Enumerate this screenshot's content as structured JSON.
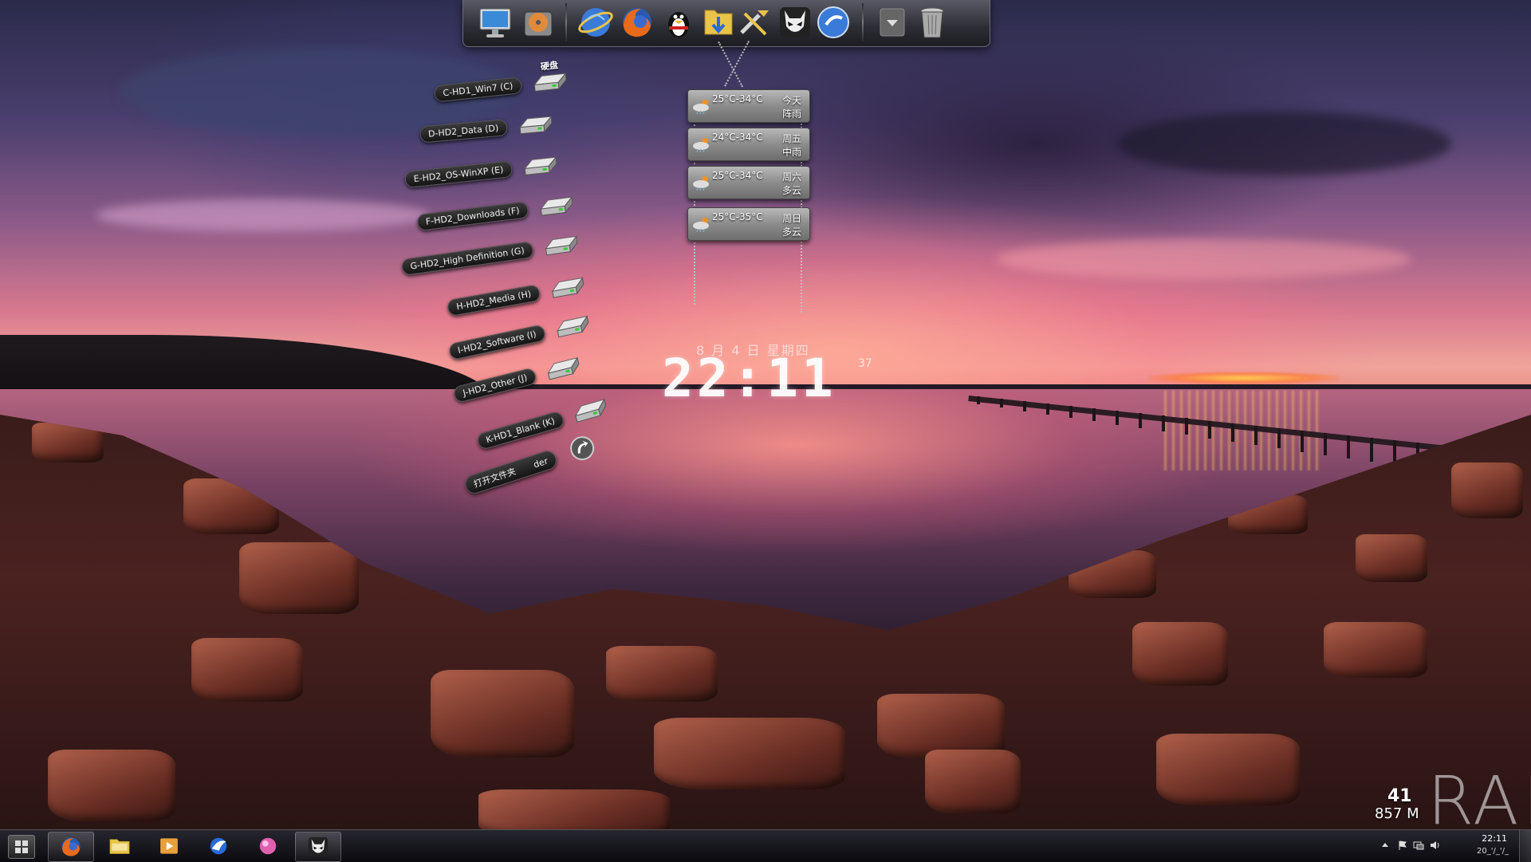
{
  "desktop": {
    "dock": {
      "items": [
        {
          "name": "computer",
          "icon": "monitor-icon"
        },
        {
          "name": "hard-disk",
          "icon": "hard-disk-icon"
        },
        {
          "name": "internet-explorer",
          "icon": "ie-globe-icon"
        },
        {
          "name": "firefox",
          "icon": "firefox-icon"
        },
        {
          "name": "qq",
          "icon": "qq-penguin-icon"
        },
        {
          "name": "downloads-folder",
          "icon": "folder-download-icon"
        },
        {
          "name": "tools",
          "icon": "wrench-tools-icon"
        },
        {
          "name": "foobar-alien",
          "icon": "alien-mask-icon"
        },
        {
          "name": "media-player",
          "icon": "blue-orb-play-icon"
        },
        {
          "name": "dock-menu",
          "icon": "dropdown-arrow-icon"
        },
        {
          "name": "recycle-bin",
          "icon": "trash-icon"
        }
      ]
    },
    "drives": [
      {
        "label": "C-HD1_Win7 (C)",
        "badge": "硬盘"
      },
      {
        "label": "D-HD2_Data (D)"
      },
      {
        "label": "E-HD2_OS-WinXP (E)"
      },
      {
        "label": "F-HD2_Downloads (F)"
      },
      {
        "label": "G-HD2_High Definition (G)"
      },
      {
        "label": "H-HD2_Media (H)"
      },
      {
        "label": "I-HD2_Software (I)"
      },
      {
        "label": "J-HD2_Other (J)"
      },
      {
        "label": "K-HD1_Blank (K)"
      },
      {
        "label": "打开文件夹",
        "suffix": "der"
      }
    ],
    "weather": [
      {
        "temp": "25°C-34°C",
        "day": "今天",
        "condition": "阵雨"
      },
      {
        "temp": "24°C-34°C",
        "day": "周五",
        "condition": "中雨"
      },
      {
        "temp": "25°C-34°C",
        "day": "周六",
        "condition": "多云"
      },
      {
        "temp": "25°C-35°C",
        "day": "周日",
        "condition": "多云"
      }
    ],
    "clock": {
      "date": "8 月 4 日  星期四",
      "time": "22:11",
      "seconds": "37"
    },
    "ram": {
      "label": "RAM",
      "percent": "41",
      "used": "857 M"
    }
  },
  "taskbar": {
    "start_icon": "windows-orb-icon",
    "pinned": [
      {
        "name": "firefox",
        "icon": "firefox-icon",
        "active": true
      },
      {
        "name": "explorer",
        "icon": "folder-icon",
        "active": false
      },
      {
        "name": "media",
        "icon": "media-player-icon",
        "active": false
      },
      {
        "name": "thunder",
        "icon": "bird-icon",
        "active": false
      },
      {
        "name": "pink-orb",
        "icon": "pink-orb-icon",
        "active": false
      },
      {
        "name": "alien",
        "icon": "alien-mask-icon",
        "active": true
      }
    ],
    "tray": {
      "time": "22:11",
      "date": "20_'/_'/_",
      "icons": [
        "up-arrow-icon",
        "flag-icon",
        "network-icon",
        "volume-icon"
      ]
    }
  }
}
